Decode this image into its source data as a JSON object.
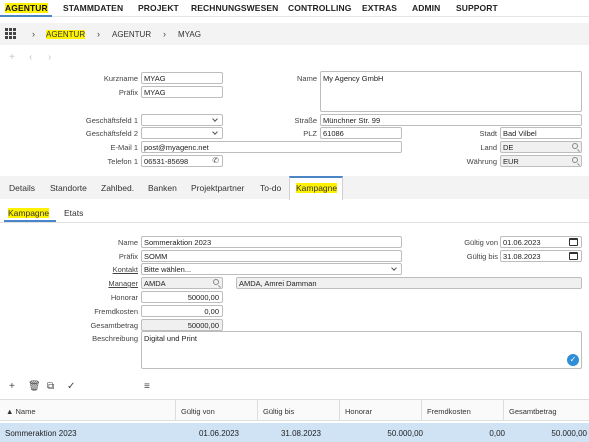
{
  "nav": {
    "items": [
      "AGENTUR",
      "STAMMDATEN",
      "PROJEKT",
      "RECHNUNGSWESEN",
      "CONTROLLING",
      "EXTRAS",
      "ADMIN",
      "SUPPORT"
    ]
  },
  "breadcrumb": [
    "AGENTUR",
    "AGENTUR",
    "MYAG"
  ],
  "form": {
    "kurzname_label": "Kurzname",
    "kurzname": "MYAG",
    "praefix_label": "Präfix",
    "praefix": "MYAG",
    "name_label": "Name",
    "name": "My Agency GmbH",
    "gf1_label": "Geschäftsfeld 1",
    "gf1": "",
    "gf2_label": "Geschäftsfeld 2",
    "gf2": "",
    "strasse_label": "Straße",
    "strasse": "Münchner Str. 99",
    "plz_label": "PLZ",
    "plz": "61086",
    "stadt_label": "Stadt",
    "stadt": "Bad Vilbel",
    "email_label": "E-Mail 1",
    "email": "post@myagenc.net",
    "land_label": "Land",
    "land": "DE",
    "tel_label": "Telefon 1",
    "tel": "06531-85698",
    "waehrung_label": "Währung",
    "waehrung": "EUR"
  },
  "tabs": [
    "Details",
    "Standorte",
    "Zahlbed.",
    "Banken",
    "Projektpartner",
    "To-do",
    "Kampagne"
  ],
  "subtabs": [
    "Kampagne",
    "Etats"
  ],
  "kampagne": {
    "name_label": "Name",
    "name": "Sommeraktion 2023",
    "praefix_label": "Präfix",
    "praefix": "SOMM",
    "kontakt_label": "Kontakt",
    "kontakt": "Bitte wählen...",
    "manager_label": "Manager",
    "manager": "AMDA",
    "manager_name": "AMDA, Amrei Damman",
    "honorar_label": "Honorar",
    "honorar": "50000,00",
    "fremd_label": "Fremdkosten",
    "fremd": "0,00",
    "gesamt_label": "Gesamtbetrag",
    "gesamt": "50000,00",
    "beschr_label": "Beschreibung",
    "beschr": "Digital und Print",
    "gueltig_von_label": "Gültig von",
    "gueltig_von": "01.06.2023",
    "gueltig_bis_label": "Gültig bis",
    "gueltig_bis": "31.08.2023"
  },
  "table": {
    "headers": [
      "▲ Name",
      "Gültig von",
      "Gültig bis",
      "Honorar",
      "Fremdkosten",
      "Gesamtbetrag"
    ],
    "rows": [
      [
        "Sommeraktion 2023",
        "01.06.2023",
        "31.08.2023",
        "50.000,00",
        "0,00",
        "50.000,00"
      ]
    ]
  },
  "icons": {
    "grid": "apps-grid-icon",
    "calendar": "calendar-icon",
    "phone": "phone-icon",
    "search": "search-icon",
    "dropdown": "chevron-down-icon",
    "check": "check-circle-icon"
  },
  "colors": {
    "highlight": "#fff200",
    "accent": "#4a86c5",
    "selected_row": "#cfe3f5"
  }
}
